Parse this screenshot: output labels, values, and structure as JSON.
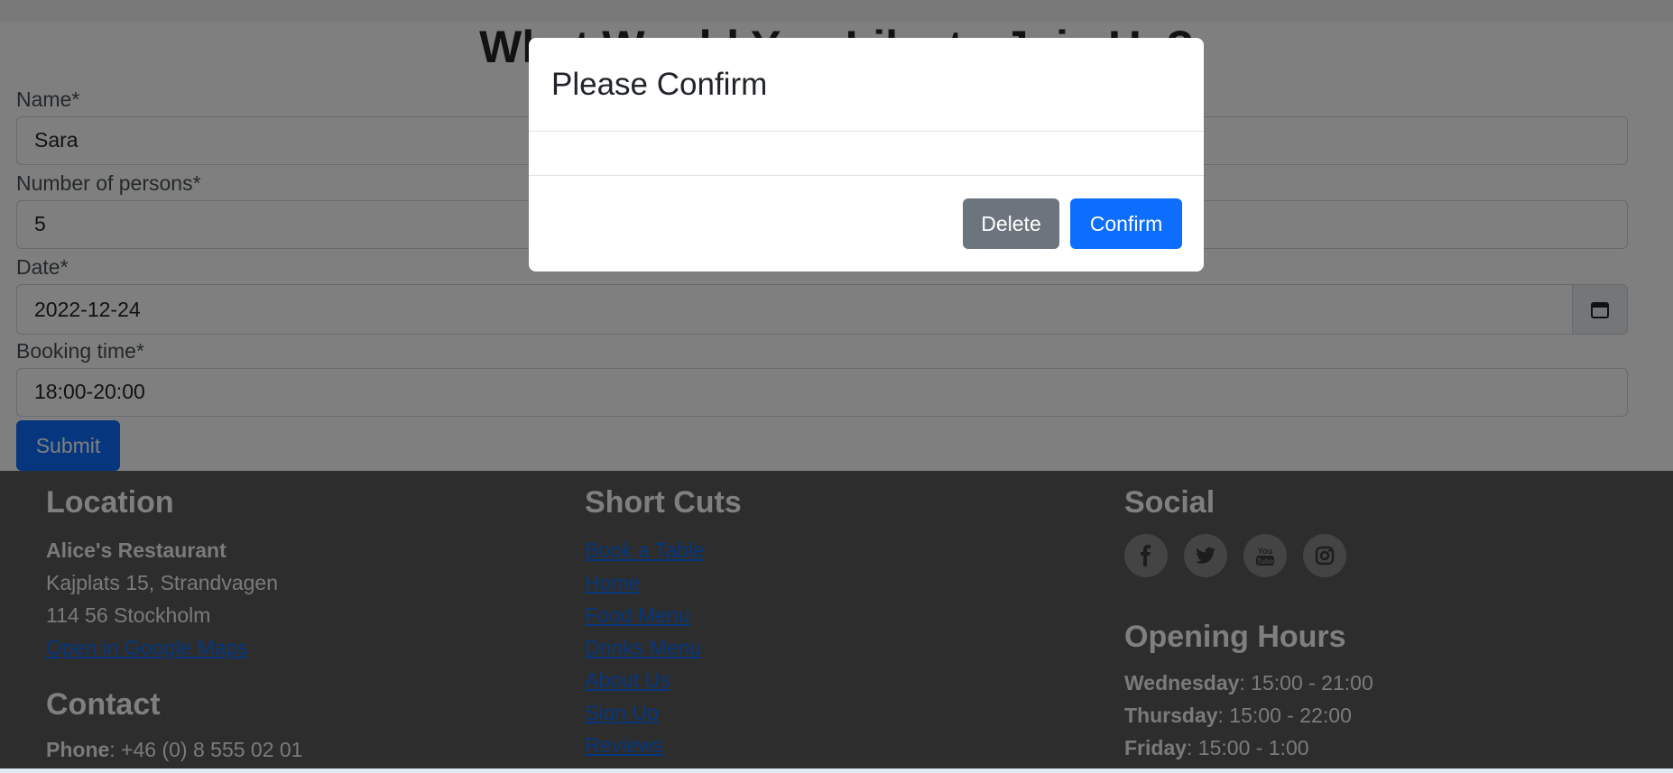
{
  "form": {
    "heading": "What Would You Like to Join Us?",
    "name_label": "Name*",
    "name_value": "Sara",
    "persons_label": "Number of persons*",
    "persons_value": "5",
    "date_label": "Date*",
    "date_value": "2022-12-24",
    "time_label": "Booking time*",
    "time_value": "18:00-20:00",
    "submit_label": "Submit"
  },
  "footer": {
    "location_heading": "Location",
    "restaurant_name": "Alice's Restaurant",
    "address_line1": "Kajplats 15, Strandvagen",
    "address_line2": "114 56 Stockholm",
    "maps_link": "Open in Google Maps",
    "contact_heading": "Contact",
    "phone_label": "Phone",
    "phone_value": ": +46 (0) 8 555 02 01",
    "shortcuts_heading": "Short Cuts",
    "shortcuts": [
      "Book a Table",
      "Home",
      "Food Menu",
      "Drinks Menu",
      "About Us",
      "Sign Up",
      "Reviews"
    ],
    "social_heading": "Social",
    "social_icons": [
      "facebook-icon",
      "twitter-icon",
      "youtube-icon",
      "instagram-icon"
    ],
    "hours_heading": "Opening Hours",
    "hours": [
      {
        "day": "Wednesday",
        "time": ": 15:00 - 21:00"
      },
      {
        "day": "Thursday",
        "time": ": 15:00 - 22:00"
      },
      {
        "day": "Friday",
        "time": ": 15:00 - 1:00"
      }
    ]
  },
  "modal": {
    "title": "Please Confirm",
    "delete_label": "Delete",
    "confirm_label": "Confirm"
  },
  "colors": {
    "primary": "#0d6efd",
    "secondary": "#6c757d",
    "footer_bg": "#5a5a5a",
    "overlay": "rgba(0,0,0,0.5)"
  }
}
